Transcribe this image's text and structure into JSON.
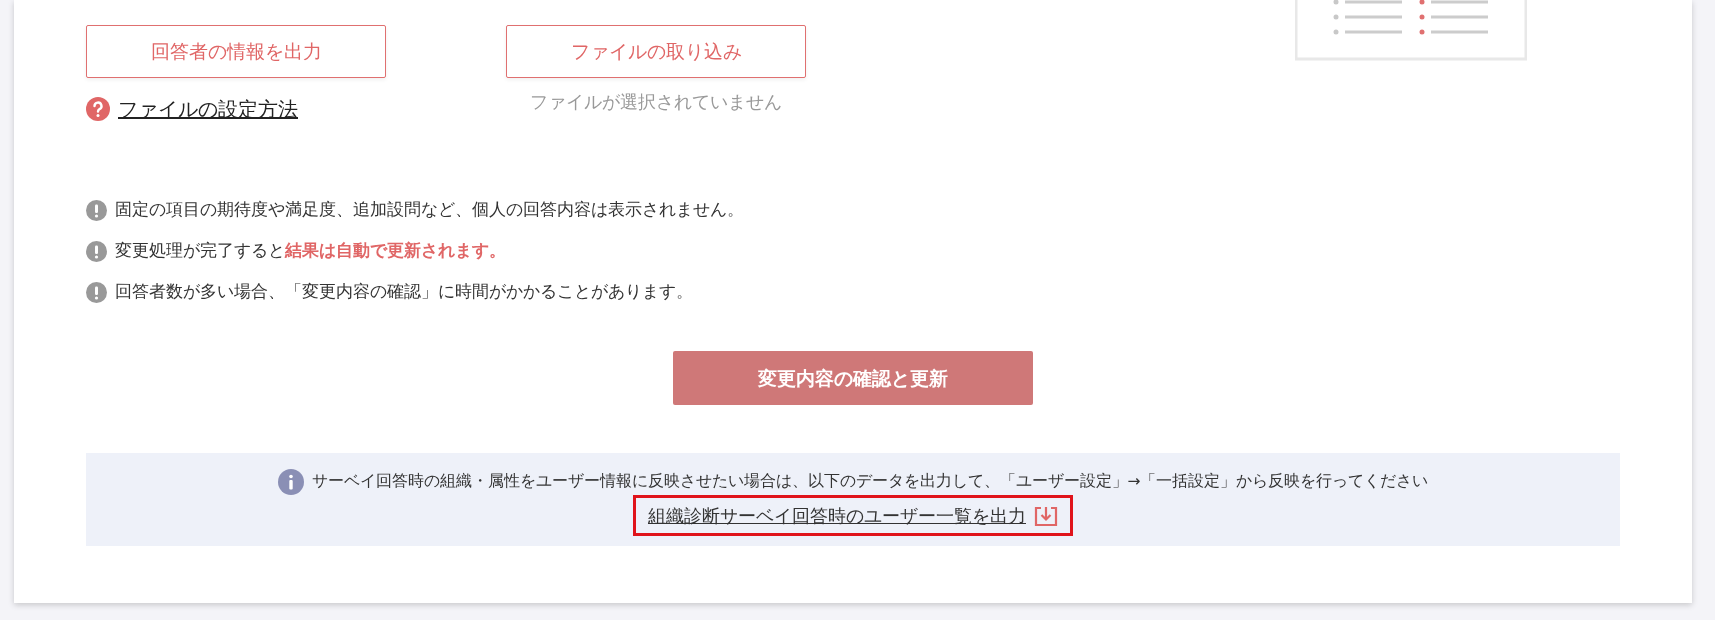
{
  "export_button": {
    "label": "回答者の情報を出力"
  },
  "help_link": {
    "label": "ファイルの設定方法"
  },
  "import_button": {
    "label": "ファイルの取り込み"
  },
  "file_status": "ファイルが選択されていません",
  "notes": [
    "固定の項目の期待度や満足度、追加設問など、個人の回答内容は表示されません。",
    "変更処理が完了すると**結果は自動で更新されます。**",
    "回答者数が多い場合、「変更内容の確認」に時間がかかることがあります。"
  ],
  "submit_button": {
    "label": "変更内容の確認と更新",
    "disabled": true
  },
  "info": {
    "text": "サーベイ回答時の組織・属性をユーザー情報に反映させたい場合は、以下のデータを出力して、「ユーザー設定」→「一括設定」から反映を行ってください",
    "link": {
      "label": "組織診断サーベイ回答時のユーザー一覧を出力",
      "highlighted": true
    }
  }
}
